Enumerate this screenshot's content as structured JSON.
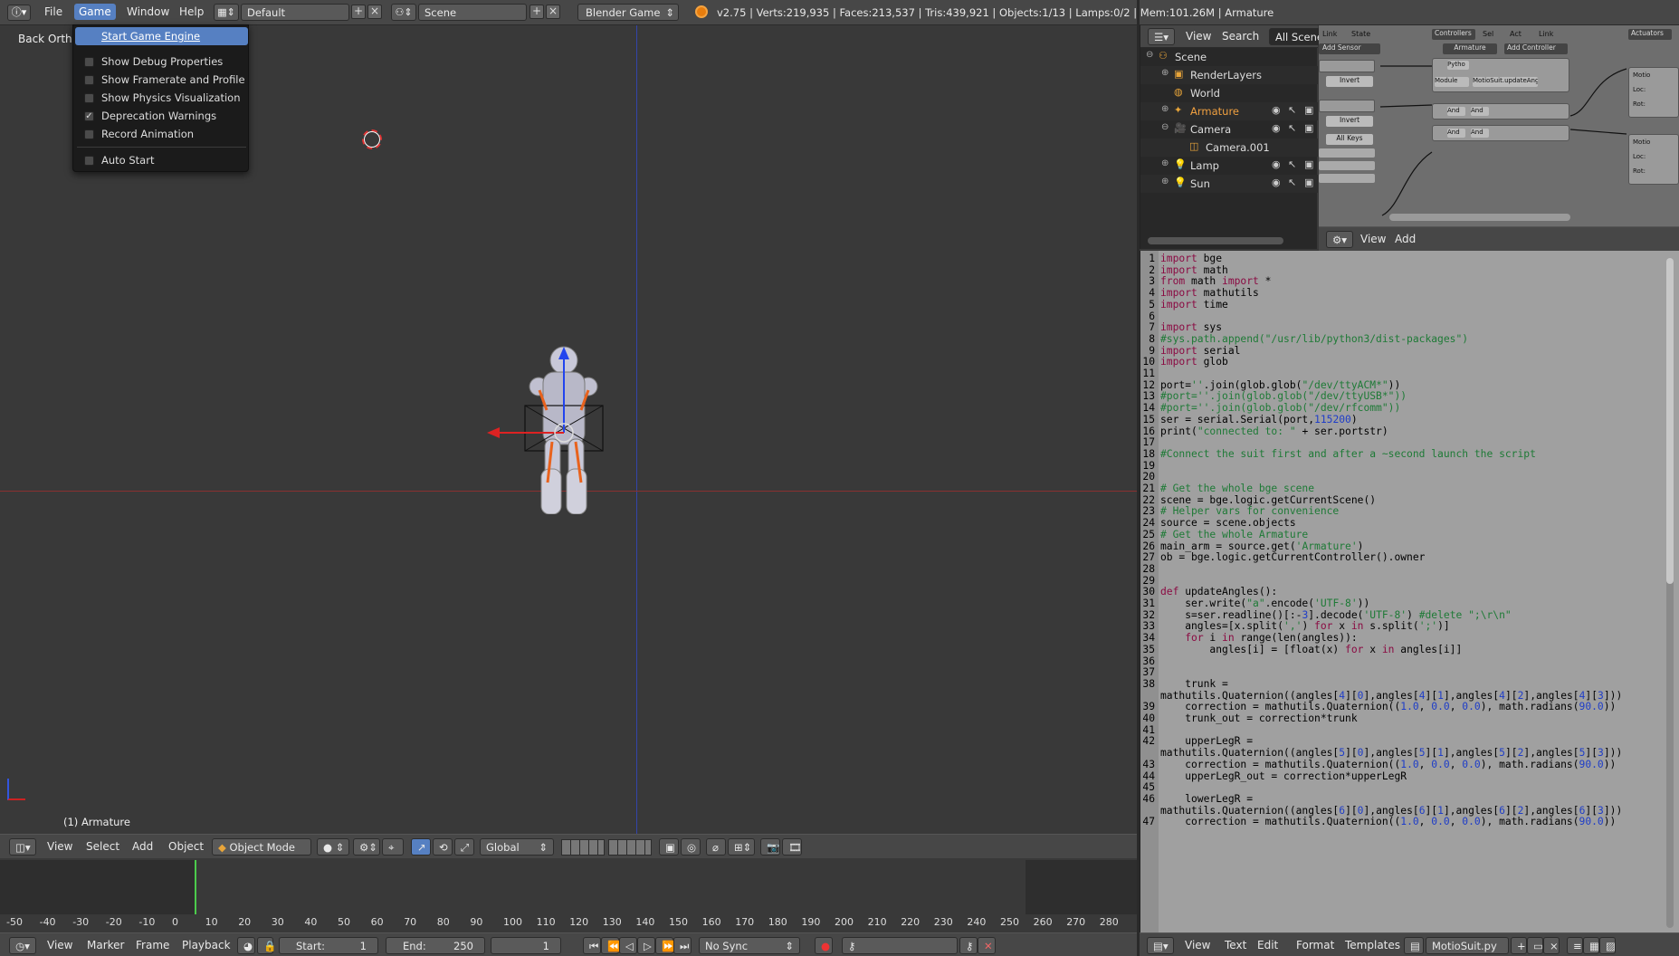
{
  "topbar": {
    "menus": [
      "File",
      "Game",
      "Window",
      "Help"
    ],
    "layout_name": "Default",
    "scene_name": "Scene",
    "engine": "Blender Game",
    "stats": "v2.75 | Verts:219,935 | Faces:213,537 | Tris:439,921 | Objects:1/13 | Lamps:0/2 | Mem:101.26M | Armature"
  },
  "game_menu": {
    "items": [
      {
        "label": "Start Game Engine",
        "checkbox": false,
        "checked": false
      },
      {
        "label": "Show Debug Properties",
        "checkbox": true,
        "checked": false
      },
      {
        "label": "Show Framerate and Profile",
        "checkbox": true,
        "checked": false
      },
      {
        "label": "Show Physics Visualization",
        "checkbox": true,
        "checked": false
      },
      {
        "label": "Deprecation Warnings",
        "checkbox": true,
        "checked": true
      },
      {
        "label": "Record Animation",
        "checkbox": true,
        "checked": false
      },
      {
        "label": "Auto Start",
        "checkbox": true,
        "checked": false
      }
    ]
  },
  "viewport": {
    "view_label": "Back Ortho",
    "object_label": "(1) Armature",
    "header": {
      "view": "View",
      "select": "Select",
      "add": "Add",
      "object": "Object",
      "mode": "Object Mode",
      "orientation": "Global"
    }
  },
  "timeline": {
    "ticks": [
      "-50",
      "-40",
      "-30",
      "-20",
      "-10",
      "0",
      "10",
      "20",
      "30",
      "40",
      "50",
      "60",
      "70",
      "80",
      "90",
      "100",
      "110",
      "120",
      "130",
      "140",
      "150",
      "160",
      "170",
      "180",
      "190",
      "200",
      "210",
      "220",
      "230",
      "240",
      "250",
      "260",
      "270",
      "280"
    ],
    "header": {
      "view": "View",
      "marker": "Marker",
      "frame": "Frame",
      "playback": "Playback",
      "start_label": "Start:",
      "start_value": "1",
      "end_label": "End:",
      "end_value": "250",
      "current_frame": "1",
      "sync": "No Sync"
    }
  },
  "outliner": {
    "header": {
      "view": "View",
      "search": "Search",
      "filter": "All Scenes"
    },
    "items": [
      {
        "name": "Scene",
        "indent": 0
      },
      {
        "name": "RenderLayers",
        "indent": 1
      },
      {
        "name": "World",
        "indent": 1
      },
      {
        "name": "Armature",
        "indent": 1
      },
      {
        "name": "Camera",
        "indent": 1
      },
      {
        "name": "Camera.001",
        "indent": 2
      },
      {
        "name": "Lamp",
        "indent": 1
      },
      {
        "name": "Sun",
        "indent": 1
      }
    ]
  },
  "logic_editor": {
    "sensors": "Sensors",
    "controllers": "Controllers",
    "actuators": "Actuators",
    "add_sensor": "Add Sensor",
    "add_controller": "Add Controller",
    "object_name": "Armature",
    "link": "Link",
    "state": "State",
    "sel": "Sel",
    "act": "Act",
    "invert": "Invert",
    "all_keys": "All Keys",
    "python": "Pytho",
    "module": "Module",
    "module_value": "MotioSuit.updateAng...",
    "and": "And",
    "motion": "Motio",
    "loc": "Loc:",
    "rot": "Rot:",
    "footer": {
      "view": "View",
      "add": "Add"
    }
  },
  "text_editor": {
    "footer": {
      "view": "View",
      "text": "Text",
      "edit": "Edit",
      "format": "Format",
      "templates": "Templates",
      "file_name": "MotioSuit.py"
    },
    "lines": [
      {
        "n": "1",
        "t": "import bge"
      },
      {
        "n": "2",
        "t": "import math"
      },
      {
        "n": "3",
        "t": "from math import *"
      },
      {
        "n": "4",
        "t": "import mathutils"
      },
      {
        "n": "5",
        "t": "import time"
      },
      {
        "n": "6",
        "t": ""
      },
      {
        "n": "7",
        "t": "import sys"
      },
      {
        "n": "8",
        "t": "#sys.path.append(\"/usr/lib/python3/dist-packages\")"
      },
      {
        "n": "9",
        "t": "import serial"
      },
      {
        "n": "10",
        "t": "import glob"
      },
      {
        "n": "11",
        "t": ""
      },
      {
        "n": "12",
        "t": "port=''.join(glob.glob(\"/dev/ttyACM*\"))"
      },
      {
        "n": "13",
        "t": "#port=''.join(glob.glob(\"/dev/ttyUSB*\"))"
      },
      {
        "n": "14",
        "t": "#port=''.join(glob.glob(\"/dev/rfcomm\"))"
      },
      {
        "n": "15",
        "t": "ser = serial.Serial(port,115200)"
      },
      {
        "n": "16",
        "t": "print(\"connected to: \" + ser.portstr)"
      },
      {
        "n": "17",
        "t": ""
      },
      {
        "n": "18",
        "t": "#Connect the suit first and after a ~second launch the script"
      },
      {
        "n": "19",
        "t": ""
      },
      {
        "n": "20",
        "t": ""
      },
      {
        "n": "21",
        "t": "# Get the whole bge scene"
      },
      {
        "n": "22",
        "t": "scene = bge.logic.getCurrentScene()"
      },
      {
        "n": "23",
        "t": "# Helper vars for convenience"
      },
      {
        "n": "24",
        "t": "source = scene.objects"
      },
      {
        "n": "25",
        "t": "# Get the whole Armature"
      },
      {
        "n": "26",
        "t": "main_arm = source.get('Armature')"
      },
      {
        "n": "27",
        "t": "ob = bge.logic.getCurrentController().owner"
      },
      {
        "n": "28",
        "t": ""
      },
      {
        "n": "29",
        "t": ""
      },
      {
        "n": "30",
        "t": "def updateAngles():"
      },
      {
        "n": "31",
        "t": "    ser.write(\"a\".encode('UTF-8'))"
      },
      {
        "n": "32",
        "t": "    s=ser.readline()[:-3].decode('UTF-8') #delete \";\\r\\n\""
      },
      {
        "n": "33",
        "t": "    angles=[x.split(',') for x in s.split(';')]"
      },
      {
        "n": "34",
        "t": "    for i in range(len(angles)):"
      },
      {
        "n": "35",
        "t": "        angles[i] = [float(x) for x in angles[i]]"
      },
      {
        "n": "36",
        "t": ""
      },
      {
        "n": "37",
        "t": ""
      },
      {
        "n": "38",
        "t": "    trunk ="
      },
      {
        "n": "",
        "t": "mathutils.Quaternion((angles[4][0],angles[4][1],angles[4][2],angles[4][3]))"
      },
      {
        "n": "39",
        "t": "    correction = mathutils.Quaternion((1.0, 0.0, 0.0), math.radians(90.0))"
      },
      {
        "n": "40",
        "t": "    trunk_out = correction*trunk"
      },
      {
        "n": "41",
        "t": ""
      },
      {
        "n": "42",
        "t": "    upperLegR ="
      },
      {
        "n": "",
        "t": "mathutils.Quaternion((angles[5][0],angles[5][1],angles[5][2],angles[5][3]))"
      },
      {
        "n": "43",
        "t": "    correction = mathutils.Quaternion((1.0, 0.0, 0.0), math.radians(90.0))"
      },
      {
        "n": "44",
        "t": "    upperLegR_out = correction*upperLegR"
      },
      {
        "n": "45",
        "t": ""
      },
      {
        "n": "46",
        "t": "    lowerLegR ="
      },
      {
        "n": "",
        "t": "mathutils.Quaternion((angles[6][0],angles[6][1],angles[6][2],angles[6][3]))"
      },
      {
        "n": "47",
        "t": "    correction = mathutils.Quaternion((1.0, 0.0, 0.0), math.radians(90.0))"
      }
    ]
  }
}
